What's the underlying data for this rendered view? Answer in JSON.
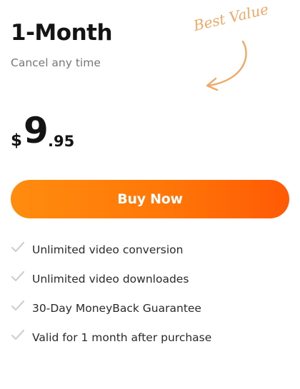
{
  "plan": {
    "title": "1-Month",
    "subtitle": "Cancel any time",
    "badge": "Best Value"
  },
  "price": {
    "currency": "$",
    "whole": "9",
    "cents": ".95"
  },
  "cta": {
    "label": "Buy Now"
  },
  "features": [
    {
      "label": "Unlimited video conversion",
      "icon": "checkmark-icon"
    },
    {
      "label": "Unlimited video downloades",
      "icon": "checkmark-icon"
    },
    {
      "label": "30-Day MoneyBack Guarantee",
      "icon": "checkmark-icon"
    },
    {
      "label": "Valid for 1 month after purchase",
      "icon": "checkmark-icon"
    }
  ],
  "colors": {
    "accent_start": "#ff8c0f",
    "accent_end": "#ff5a05",
    "badge": "#f0a866",
    "check": "#cfcfcf"
  }
}
